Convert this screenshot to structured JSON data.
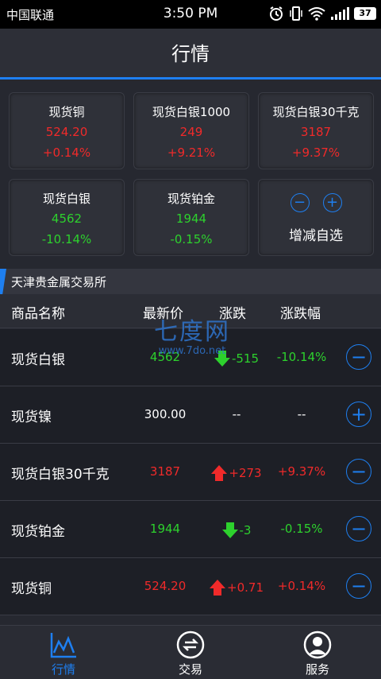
{
  "status_bar": {
    "carrier": "中国联通",
    "time": "3:50 PM",
    "battery": "37"
  },
  "header": {
    "title": "行情"
  },
  "cards": [
    {
      "name": "现货铜",
      "price": "524.20",
      "pct": "+0.14%",
      "color": "#f02a2a"
    },
    {
      "name": "现货白银1000",
      "price": "249",
      "pct": "+9.21%",
      "color": "#f02a2a"
    },
    {
      "name": "现货白银30千克",
      "price": "3187",
      "pct": "+9.37%",
      "color": "#f02a2a"
    },
    {
      "name": "现货白银",
      "price": "4562",
      "pct": "-10.14%",
      "color": "#2dd12d"
    },
    {
      "name": "现货铂金",
      "price": "1944",
      "pct": "-0.15%",
      "color": "#2dd12d"
    }
  ],
  "add_card": {
    "label": "增减自选",
    "minus": "−",
    "plus": "+"
  },
  "exchange": {
    "name": "天津贵金属交易所"
  },
  "table": {
    "headers": {
      "name": "商品名称",
      "price": "最新价",
      "change": "涨跌",
      "pct": "涨跌幅"
    },
    "rows": [
      {
        "name": "现货白银",
        "price": "4562",
        "change": "-515",
        "pct": "-10.14%",
        "trend": "down",
        "action": "−"
      },
      {
        "name": "现货镍",
        "price": "300.00",
        "change": "--",
        "pct": "--",
        "trend": "none",
        "action": "+"
      },
      {
        "name": "现货白银30千克",
        "price": "3187",
        "change": "+273",
        "pct": "+9.37%",
        "trend": "up",
        "action": "−"
      },
      {
        "name": "现货铂金",
        "price": "1944",
        "change": "-3",
        "pct": "-0.15%",
        "trend": "down",
        "action": "−"
      },
      {
        "name": "现货铜",
        "price": "524.20",
        "change": "+0.71",
        "pct": "+0.14%",
        "trend": "up",
        "action": "−"
      }
    ]
  },
  "watermark": {
    "big": "七度网",
    "small": "www.7do.net"
  },
  "tabs": [
    {
      "label": "行情",
      "icon": "chart-icon",
      "active": true
    },
    {
      "label": "交易",
      "icon": "exchange-icon",
      "active": false
    },
    {
      "label": "服务",
      "icon": "user-service-icon",
      "active": false
    }
  ],
  "colors": {
    "accent": "#1e7ff0",
    "up": "#f02a2a",
    "down": "#2dd12d"
  }
}
